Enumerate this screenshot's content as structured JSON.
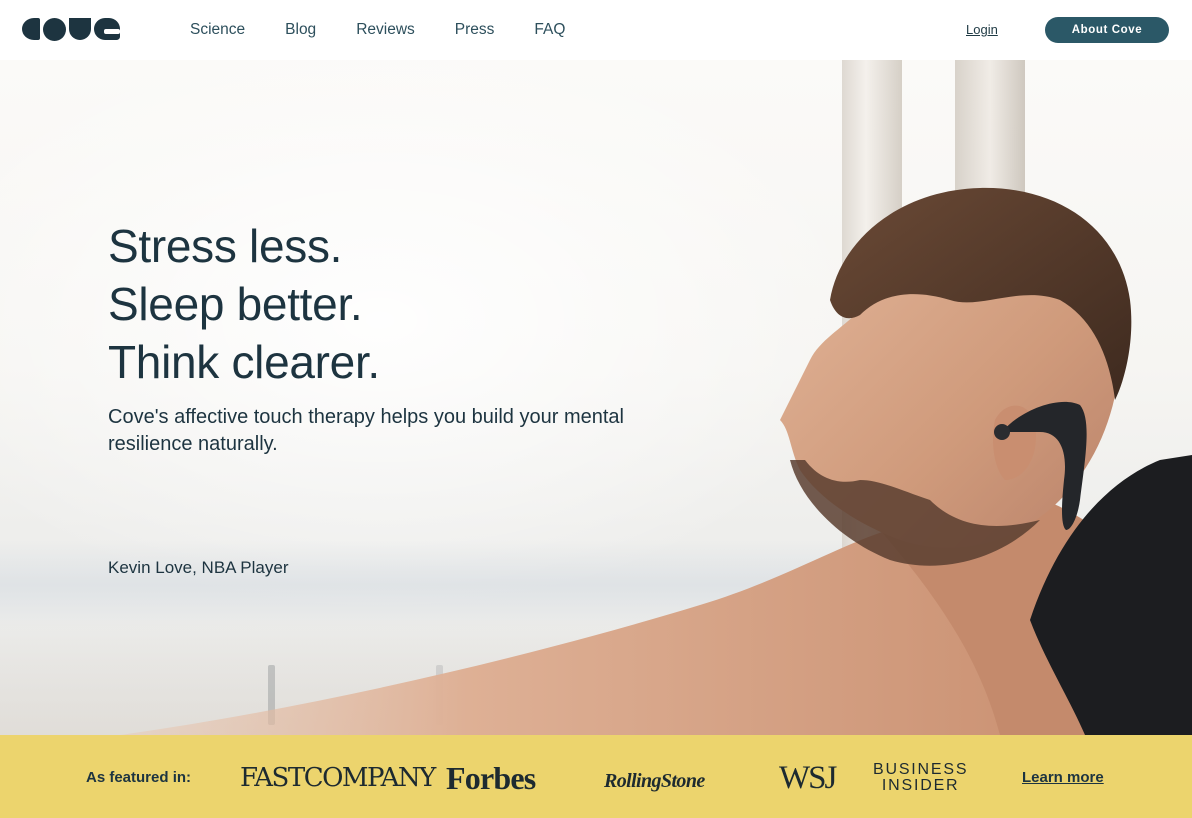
{
  "brand": {
    "logo_text": "cove"
  },
  "nav": {
    "items": [
      {
        "label": "Science"
      },
      {
        "label": "Blog"
      },
      {
        "label": "Reviews"
      },
      {
        "label": "Press"
      },
      {
        "label": "FAQ"
      }
    ],
    "login_label": "Login",
    "about_label": "About Cove"
  },
  "hero": {
    "headline_lines": [
      "Stress less.",
      "Sleep better.",
      "Think clearer."
    ],
    "subheadline": "Cove's affective touch therapy helps you build your mental resilience naturally.",
    "caption": "Kevin Love, NBA Player"
  },
  "press": {
    "label": "As featured in:",
    "outlets": {
      "fastcompany": "FASTCOMPANY",
      "forbes": "Forbes",
      "rollingstone": "RollingStone",
      "wsj": "WSJ",
      "business_insider_line1": "BUSINESS",
      "business_insider_line2": "INSIDER"
    },
    "learn_more": "Learn more"
  },
  "colors": {
    "brand_dark": "#1d3440",
    "button": "#2b5867",
    "press_bar": "#ecd46d"
  }
}
